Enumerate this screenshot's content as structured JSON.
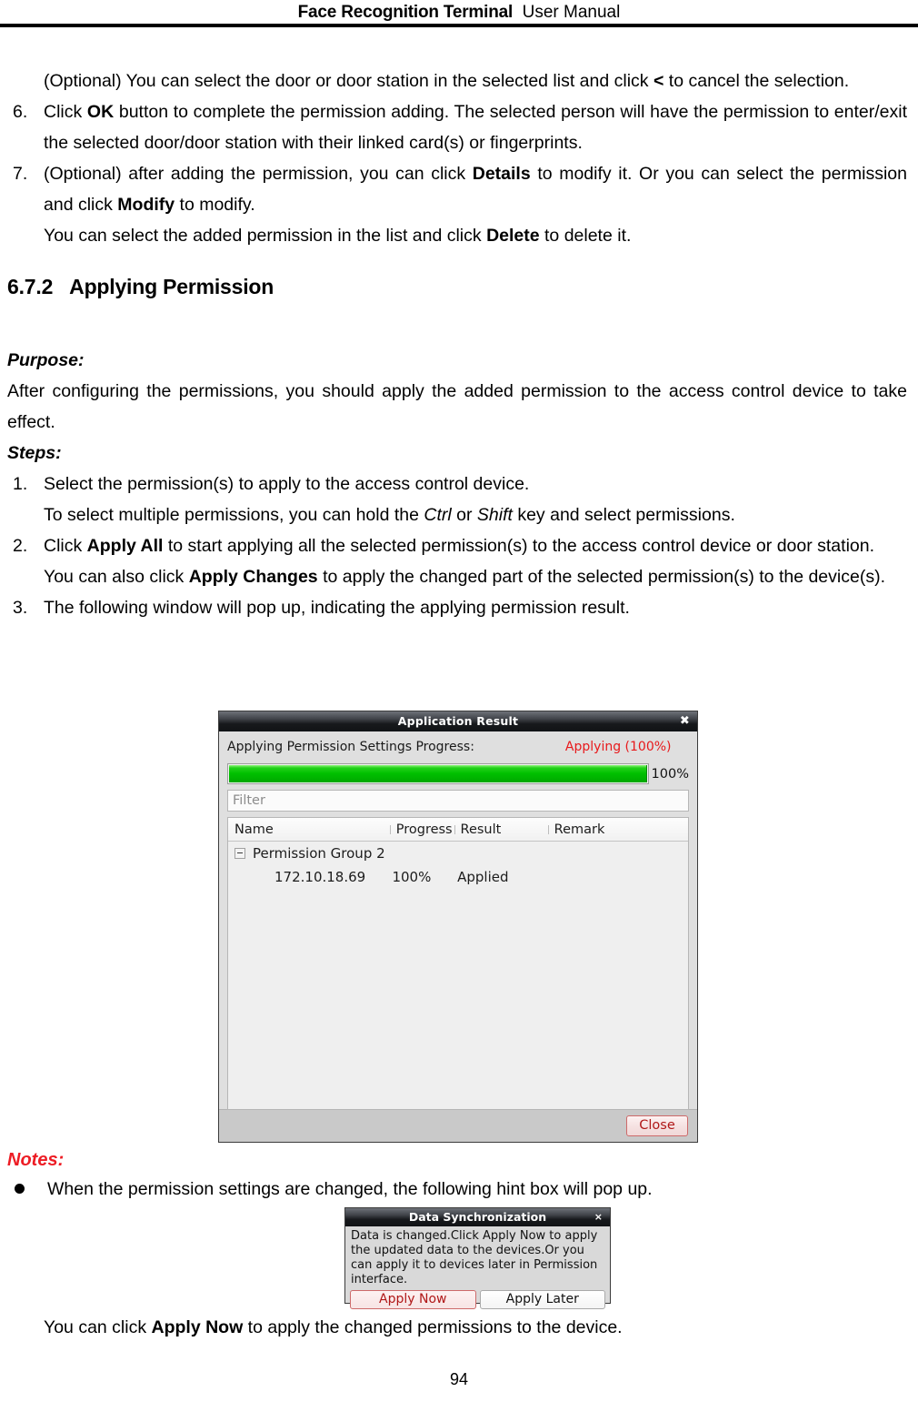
{
  "header": {
    "title_bold": "Face Recognition Terminal",
    "title_regular": "User Manual"
  },
  "body": {
    "optional_line_1": "(Optional) You can select the door or door station in the selected list and click ",
    "optional_line_1_bold": "<",
    "optional_line_1_tail": " to cancel the selection.",
    "step6": {
      "num": "6.",
      "pre": "Click ",
      "bold": "OK",
      "post": " button to complete the permission adding. The selected person will have the permission to enter/exit the selected door/door station with their linked card(s) or fingerprints."
    },
    "step7": {
      "num": "7.",
      "pre": "(Optional) after adding the permission, you can click ",
      "bold1": "Details",
      "mid": " to modify it. Or you can select the permission and click ",
      "bold2": "Modify",
      "post": " to modify.",
      "subline_pre": "You can select the added permission in the list and click ",
      "subline_bold": "Delete",
      "subline_post": " to delete it."
    },
    "section": {
      "number": "6.7.2",
      "title": "Applying Permission"
    },
    "purpose_label": "Purpose:",
    "purpose_text": "After configuring the permissions, you should apply the added permission to the access control device to take effect.",
    "steps_label": "Steps:",
    "step1": {
      "num": "1.",
      "text": "Select the permission(s) to apply to the access control device.",
      "subline_pre": "To select multiple permissions, you can hold the ",
      "subline_italic1": "Ctrl",
      "subline_mid": " or ",
      "subline_italic2": "Shift",
      "subline_post": " key and select permissions."
    },
    "step2": {
      "num": "2.",
      "pre": "Click ",
      "bold": "Apply All",
      "post": " to start applying all the selected permission(s) to the access control device or door station.",
      "subline_pre": "You can also click ",
      "subline_bold": "Apply Changes",
      "subline_post": " to apply the changed part of the selected permission(s) to the device(s)."
    },
    "step3": {
      "num": "3.",
      "text": "The following window will pop up, indicating the applying permission result."
    },
    "notes_label": "Notes:",
    "note_bullet_1": "When the permission settings are changed, the following hint box will pop up.",
    "closing_pre": "You can click ",
    "closing_bold": "Apply Now",
    "closing_post": " to apply the changed permissions to the device."
  },
  "application_result_dialog": {
    "title": "Application Result",
    "close_icon": "close-icon",
    "close_glyph": "✖",
    "progress_label": "Applying Permission Settings Progress:",
    "progress_status": "Applying (100%)",
    "progress_status_color": "#e8191b",
    "progress_percent_text": "100%",
    "progress_percent_value": 100,
    "progress_bar_color": "#00c000",
    "filter_placeholder": "Filter",
    "filter_value": "",
    "table": {
      "columns": [
        "Name",
        "Progress",
        "Result",
        "Remark"
      ],
      "group": {
        "toggle_icon": "collapse-minus-icon",
        "name": "Permission Group 2",
        "children": [
          {
            "name": "172.10.18.69",
            "progress": "100%",
            "result": "Applied",
            "remark": ""
          }
        ]
      }
    },
    "close_button": "Close",
    "close_button_color": "#b01818"
  },
  "data_sync_dialog": {
    "title": "Data Synchronization",
    "close_icon": "close-icon",
    "close_glyph": "×",
    "message": "Data is changed.Click Apply Now to apply the updated data to the devices.Or you can apply it to devices later in Permission interface.",
    "apply_now_label": "Apply Now",
    "apply_later_label": "Apply Later",
    "apply_now_color": "#b01818"
  },
  "footer": {
    "page_number": "94"
  }
}
